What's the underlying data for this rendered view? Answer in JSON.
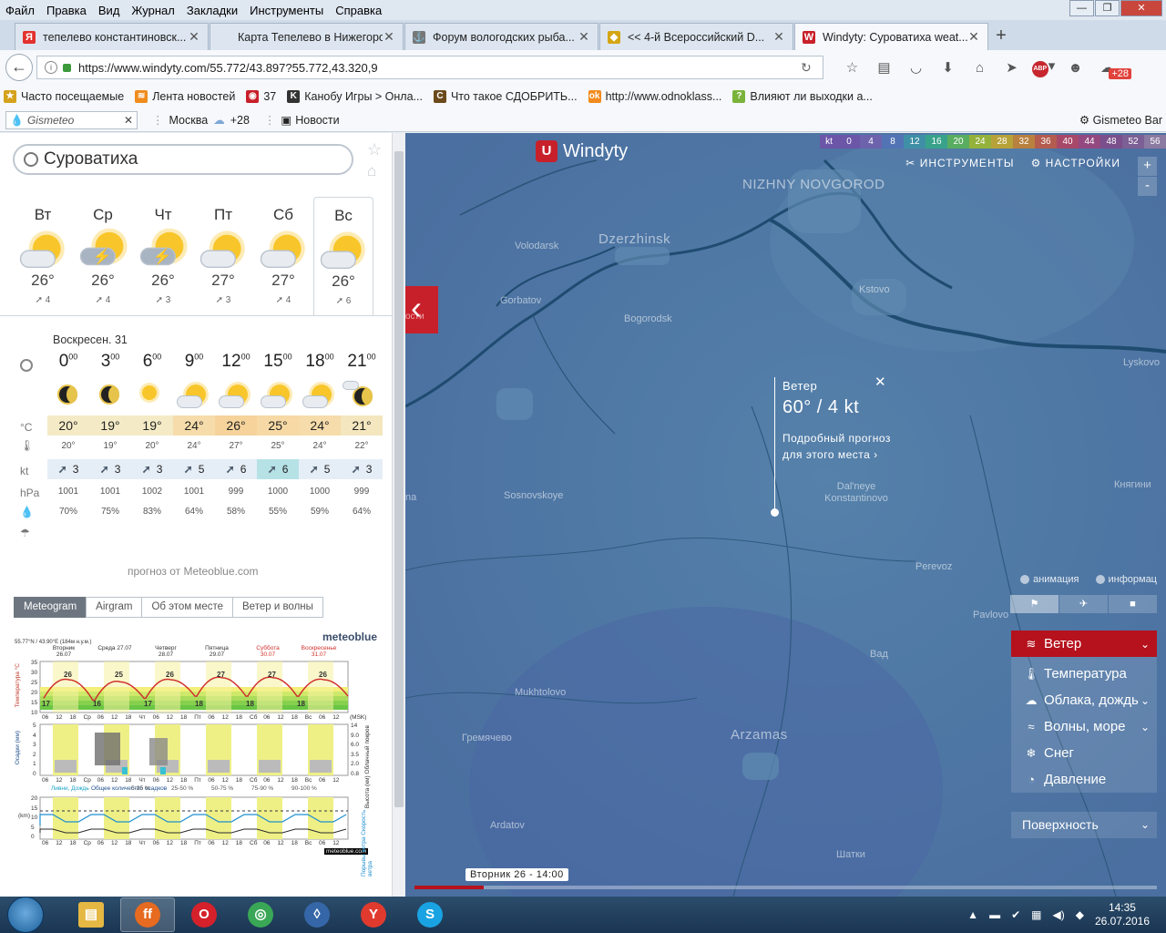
{
  "menubar": [
    "Файл",
    "Правка",
    "Вид",
    "Журнал",
    "Закладки",
    "Инструменты",
    "Справка"
  ],
  "tabs": [
    {
      "title": "тепелево константиновск...",
      "icon": "Я",
      "color": "#e3312d"
    },
    {
      "title": "Карта Тепелево в Нижегород...",
      "icon": "",
      "color": "#dde6f0"
    },
    {
      "title": "Форум вологодских рыба...",
      "icon": "⚓",
      "color": "#777777"
    },
    {
      "title": "<< 4-й Всероссийский D...",
      "icon": "◆",
      "color": "#d4a514"
    },
    {
      "title": "Windyty: Суроватиха weat...",
      "icon": "W",
      "color": "#c8202a"
    }
  ],
  "url": "https://www.windyty.com/55.772/43.897?55.772,43.320,9",
  "nav_badge": "+28",
  "bookmarks": [
    {
      "label": "Часто посещаемые",
      "icon": "★",
      "color": "#d5a21c"
    },
    {
      "label": "Лента новостей",
      "icon": "≋",
      "color": "#f08c1e"
    },
    {
      "label": "37",
      "icon": "◉",
      "color": "#c8202a"
    },
    {
      "label": "Канобу Игры > Онла...",
      "icon": "K",
      "color": "#333333"
    },
    {
      "label": "Что такое СДОБРИТЬ...",
      "icon": "C",
      "color": "#6b4a1c"
    },
    {
      "label": "http://www.odnoklass...",
      "icon": "ok",
      "color": "#f28a1e"
    },
    {
      "label": "Влияют ли выходки а...",
      "icon": "?",
      "color": "#7ab33a"
    }
  ],
  "gismeteo": {
    "placeholder": "Gismeteo",
    "city": "Москва",
    "temp": "+28",
    "news": "Новости",
    "bar": "Gismeteo Bar"
  },
  "panel": {
    "search": "Суроватиха",
    "days": [
      {
        "name": "Вт",
        "temp": "26°",
        "wind": "4",
        "icon": "sun-cloud"
      },
      {
        "name": "Ср",
        "temp": "26°",
        "wind": "4",
        "icon": "storm"
      },
      {
        "name": "Чт",
        "temp": "26°",
        "wind": "3",
        "icon": "storm"
      },
      {
        "name": "Пт",
        "temp": "27°",
        "wind": "3",
        "icon": "sun-cloud"
      },
      {
        "name": "Сб",
        "temp": "27°",
        "wind": "4",
        "icon": "sun-cloud"
      },
      {
        "name": "Вс",
        "temp": "26°",
        "wind": "6",
        "icon": "sun-cloud"
      }
    ],
    "date_label": "Воскресен. 31",
    "hours": [
      "0",
      "3",
      "6",
      "9",
      "12",
      "15",
      "18",
      "21"
    ],
    "hour_icons": [
      "moon",
      "moon",
      "sun",
      "sun-cloud",
      "sun-cloud",
      "sun-cloud",
      "sun-cloud",
      "moon-cloud"
    ],
    "units": {
      "temp": "°C",
      "wind": "kt",
      "pressure": "hPa"
    },
    "temps": [
      "20°",
      "19°",
      "19°",
      "24°",
      "26°",
      "25°",
      "24°",
      "21°"
    ],
    "feels": [
      "20°",
      "19°",
      "20°",
      "24°",
      "27°",
      "25°",
      "24°",
      "22°"
    ],
    "winds": [
      "3",
      "3",
      "3",
      "5",
      "6",
      "6",
      "5",
      "3"
    ],
    "pressures": [
      "1001",
      "1001",
      "1002",
      "1001",
      "999",
      "1000",
      "1000",
      "999"
    ],
    "humidity": [
      "70%",
      "75%",
      "83%",
      "64%",
      "58%",
      "55%",
      "59%",
      "64%"
    ],
    "credit": "прогноз от Meteoblue.com",
    "tabs": [
      "Meteogram",
      "Airgram",
      "Об этом месте",
      "Ветер и волны"
    ],
    "meteogram": {
      "brand": "meteoblue",
      "coords": "55.77°N / 43.90°E (184м н.у.м.)",
      "day_labels": [
        "Вторник 26.07",
        "Среда 27.07",
        "Четверг 28.07",
        "Пятница 29.07",
        "Суббота 30.07",
        "Воскресенье 31.07"
      ],
      "day_highs": [
        "26",
        "25",
        "26",
        "27",
        "27",
        "26"
      ],
      "day_lows": [
        "17",
        "16",
        "17",
        "18",
        "18",
        "18"
      ],
      "x_ticks": [
        "06",
        "12",
        "18",
        "Ср",
        "06",
        "12",
        "18",
        "Чт",
        "06",
        "12",
        "18",
        "Пт",
        "06",
        "12",
        "18",
        "Сб",
        "06",
        "12",
        "18",
        "Вс",
        "06",
        "12"
      ],
      "temp_axis": [
        "35",
        "30",
        "25",
        "20",
        "15",
        "10"
      ],
      "precip_axis": [
        "5",
        "4",
        "3",
        "2",
        "1",
        "0"
      ],
      "cloud_axis": [
        "14",
        "9.0",
        "6.0",
        "3.5",
        "2.0",
        "0.8"
      ],
      "wind_axis": [
        "20",
        "15",
        "10",
        "5",
        "0"
      ],
      "temp_label": "Температура °C",
      "precip_label": "Осадки (мм)",
      "cloud_label": "Высота (км) Облачный покров",
      "wind_label_right": "Порывы ветра Скорость ветра",
      "wind_axis_label": "(km)",
      "tz": "(MSK)",
      "precip_legend": [
        "Ливни, Дождь",
        "Общее количество осадков",
        "5-25 %",
        "25-50 %",
        "50-75 %",
        "75-90 %",
        "90-100 %"
      ],
      "footer_brand": "meteoblue.com"
    }
  },
  "map": {
    "logo": "Windyty",
    "scale_unit": "kt",
    "scale": [
      {
        "v": "0",
        "c": "#6b56a8"
      },
      {
        "v": "4",
        "c": "#6d63ad"
      },
      {
        "v": "8",
        "c": "#5274b5"
      },
      {
        "v": "12",
        "c": "#3f90a6"
      },
      {
        "v": "16",
        "c": "#38a38a"
      },
      {
        "v": "20",
        "c": "#59ad60"
      },
      {
        "v": "24",
        "c": "#94b23a"
      },
      {
        "v": "28",
        "c": "#b7a23a"
      },
      {
        "v": "32",
        "c": "#b9813f"
      },
      {
        "v": "36",
        "c": "#b45c4f"
      },
      {
        "v": "40",
        "c": "#a84868"
      },
      {
        "v": "44",
        "c": "#93487f"
      },
      {
        "v": "48",
        "c": "#7a4f8c"
      },
      {
        "v": "52",
        "c": "#7c5f94"
      },
      {
        "v": "56",
        "c": "#8b7aa1"
      }
    ],
    "tools": "ИНСТРУМЕНТЫ",
    "settings": "НАСТРОЙКИ",
    "zoom_in": "+",
    "zoom_out": "-",
    "back_label": "ости",
    "cities": [
      {
        "name": "NIZHNY NOVGOROD",
        "big": true
      },
      {
        "name": "Dzerzhinsk",
        "big": true
      },
      {
        "name": "Volodarsk"
      },
      {
        "name": "Gorbatov"
      },
      {
        "name": "Bogorodsk"
      },
      {
        "name": "Kstovo"
      },
      {
        "name": "Lyskovo"
      },
      {
        "name": "Pavlovo"
      },
      {
        "name": "Sosnovskoye"
      },
      {
        "name": "Dal'neye Konstantinovo"
      },
      {
        "name": "Княгини"
      },
      {
        "name": "Perevoz"
      },
      {
        "name": "Mukhtolovo"
      },
      {
        "name": "Arzamas",
        "big": true
      },
      {
        "name": "Ardatov"
      },
      {
        "name": "Гремячево"
      },
      {
        "name": "Вад"
      },
      {
        "name": "Шатки"
      },
      {
        "name": "na"
      }
    ],
    "popup": {
      "title": "Ветер",
      "value": "60° / 4 kt",
      "desc": "Подробный прогноз для этого места"
    },
    "options": [
      "анимация",
      "информац"
    ],
    "layers": [
      {
        "label": "Ветер",
        "icon": "≋",
        "chevron": true,
        "active": true
      },
      {
        "label": "Температура",
        "icon": "🌡",
        "chevron": false
      },
      {
        "label": "Облака, дождь",
        "icon": "☁",
        "chevron": true
      },
      {
        "label": "Волны, море",
        "icon": "≈",
        "chevron": true
      },
      {
        "label": "Снег",
        "icon": "❄",
        "chevron": false
      },
      {
        "label": "Давление",
        "icon": "◔",
        "chevron": false
      }
    ],
    "surface": "Поверхность",
    "time_label": "Вторник 26 - 14:00"
  },
  "taskbar": {
    "apps": [
      {
        "name": "explorer",
        "icon": "▤",
        "color": "#e4b843"
      },
      {
        "name": "firefox",
        "icon": "ff",
        "color": "#e66a1f",
        "active": true
      },
      {
        "name": "opera",
        "icon": "O",
        "color": "#d4212c"
      },
      {
        "name": "chrome",
        "icon": "◎",
        "color": "#3aa757"
      },
      {
        "name": "unknown",
        "icon": "◊",
        "color": "#3567a8"
      },
      {
        "name": "yandex",
        "icon": "Y",
        "color": "#e03a2f"
      },
      {
        "name": "skype",
        "icon": "S",
        "color": "#1aa3e3"
      }
    ],
    "time": "14:35",
    "date": "26.07.2016"
  }
}
